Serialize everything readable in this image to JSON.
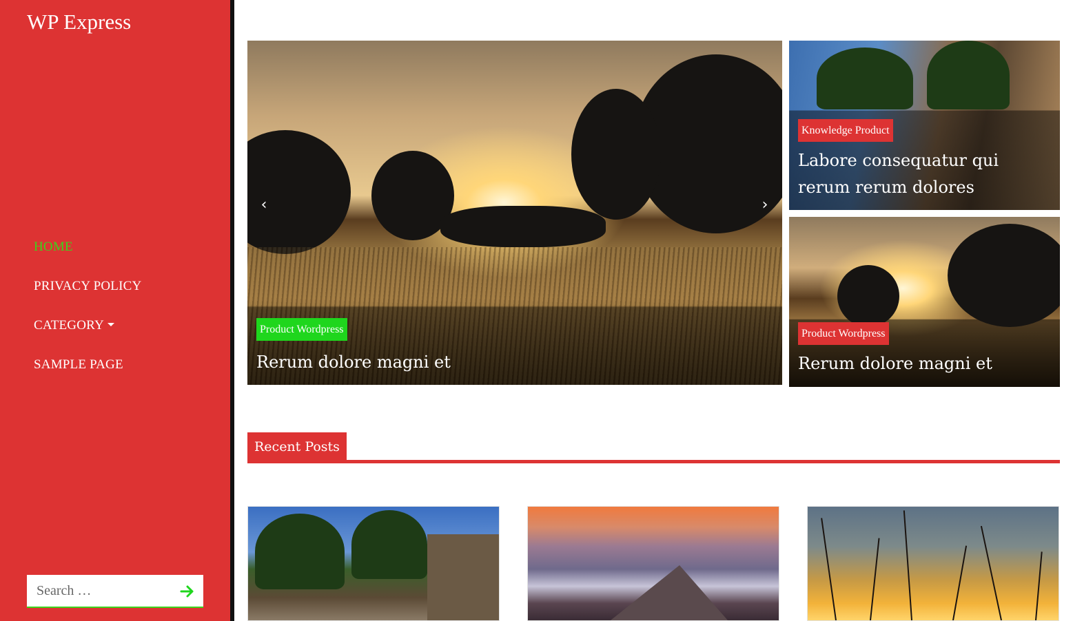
{
  "site": {
    "title": "WP Express"
  },
  "nav": {
    "items": [
      {
        "label": "HOME",
        "active": true
      },
      {
        "label": "PRIVACY POLICY",
        "active": false
      },
      {
        "label": "CATEGORY",
        "active": false,
        "has_dropdown": true
      },
      {
        "label": "SAMPLE PAGE",
        "active": false
      }
    ]
  },
  "search": {
    "placeholder": "Search …",
    "button_icon": "arrow-right-icon"
  },
  "slider": {
    "prev_icon": "‹",
    "next_icon": "›",
    "current": {
      "category": "Product Wordpress",
      "title": "Rerum dolore magni et"
    }
  },
  "featured": [
    {
      "category": "Knowledge Product",
      "title": "Labore consequatur qui rerum rerum dolores"
    },
    {
      "category": "Product Wordpress",
      "title": "Rerum dolore magni et"
    }
  ],
  "recent_posts": {
    "heading": "Recent Posts",
    "items": [
      {
        "image": "tropical-resort-image"
      },
      {
        "image": "snowy-road-sunset-image"
      },
      {
        "image": "grass-sunset-image"
      }
    ]
  },
  "colors": {
    "brand_red": "#dd3333",
    "accent_green": "#1fd61d",
    "active_nav": "#3cd31c",
    "sidebar_border": "#111111"
  }
}
